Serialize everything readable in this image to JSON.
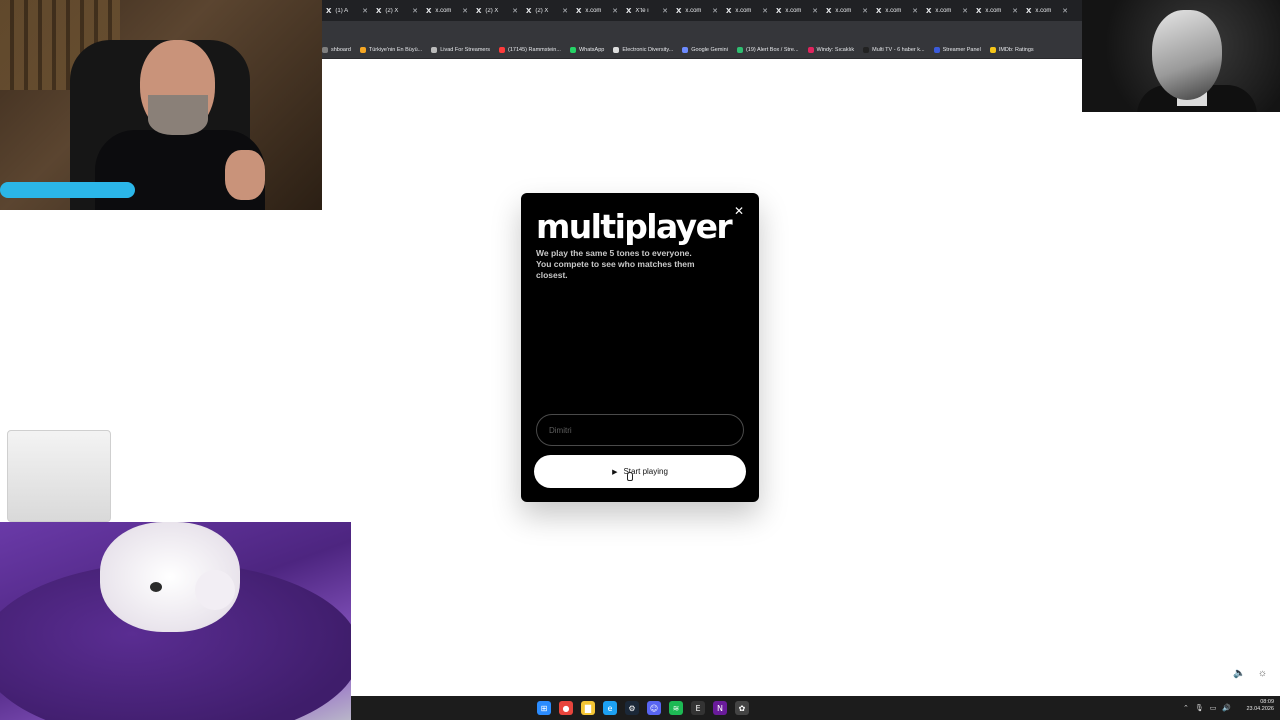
{
  "browser": {
    "tabs": [
      {
        "label": "(1) A"
      },
      {
        "label": "(2) X"
      },
      {
        "label": "x.com"
      },
      {
        "label": "(2) X"
      },
      {
        "label": "(2) X"
      },
      {
        "label": "x.com"
      },
      {
        "label": "X'te i"
      },
      {
        "label": "x.com"
      },
      {
        "label": "x.com"
      },
      {
        "label": "x.com"
      },
      {
        "label": "x.com"
      },
      {
        "label": "x.com"
      },
      {
        "label": "x.com"
      },
      {
        "label": "x.com"
      },
      {
        "label": "x.com"
      }
    ],
    "bookmarks": [
      {
        "label": "shboard",
        "color": "#7f7f7f"
      },
      {
        "label": "Türkiye'nin En Büyü...",
        "color": "#f5a623"
      },
      {
        "label": "Livad For Streamers",
        "color": "#bbbbbb"
      },
      {
        "label": "(17145) Rammstein...",
        "color": "#ff3b3b"
      },
      {
        "label": "WhatsApp",
        "color": "#25d366"
      },
      {
        "label": "Electronic Diversity...",
        "color": "#dddddd"
      },
      {
        "label": "Google Gemini",
        "color": "#6d8bff"
      },
      {
        "label": "(19) Alert Box / Stre...",
        "color": "#2fbf71"
      },
      {
        "label": "Windy: Sıcaklık",
        "color": "#e0245e"
      },
      {
        "label": "Multi TV - 6 haber k...",
        "color": "#222222"
      },
      {
        "label": "Streamer Panel",
        "color": "#3b5bdb"
      },
      {
        "label": "IMDb: Ratings",
        "color": "#f5c518"
      }
    ]
  },
  "modal": {
    "title": "multiplayer",
    "description": "We play the same 5 tones to everyone. You compete to see who matches them closest.",
    "close_glyph": "✕",
    "name_placeholder": "Dimitri",
    "start_label": "Start playing",
    "play_glyph": "▶"
  },
  "page_controls": {
    "volume_icon": "volume-icon",
    "theme_icon": "sun-icon",
    "volume_glyph": "🔈",
    "theme_glyph": "☼"
  },
  "taskbar": {
    "apps": [
      {
        "name": "windows-start-icon",
        "glyph": "⊞",
        "color": "#2b8cff"
      },
      {
        "name": "chrome-icon",
        "glyph": "●",
        "color": "#e8453c"
      },
      {
        "name": "file-explorer-icon",
        "glyph": "▇",
        "color": "#f4c534"
      },
      {
        "name": "edge-icon",
        "glyph": "e",
        "color": "#1da1f2"
      },
      {
        "name": "steam-icon",
        "glyph": "⚙",
        "color": "#1b2838"
      },
      {
        "name": "discord-icon",
        "glyph": "☺",
        "color": "#5865f2"
      },
      {
        "name": "spotify-icon",
        "glyph": "≋",
        "color": "#1db954"
      },
      {
        "name": "epic-games-icon",
        "glyph": "E",
        "color": "#333333"
      },
      {
        "name": "next-app-icon",
        "glyph": "N",
        "color": "#6a1b9a"
      },
      {
        "name": "settings-app-icon",
        "glyph": "✿",
        "color": "#444444"
      }
    ],
    "clock_time": "08:09",
    "clock_date": "23.04.2026"
  }
}
